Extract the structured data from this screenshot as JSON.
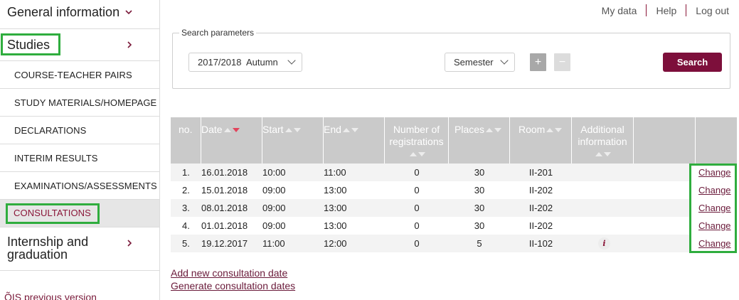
{
  "sidebar": {
    "general_information": "General information",
    "studies": "Studies",
    "sub_items": [
      "COURSE-TEACHER PAIRS",
      "STUDY MATERIALS/HOMEPAGE",
      "DECLARATIONS",
      "INTERIM RESULTS",
      "EXAMINATIONS/ASSESSMENTS",
      "CONSULTATIONS"
    ],
    "internship_line1": "Internship and",
    "internship_line2": "graduation",
    "previous_version": "ÕIS previous version"
  },
  "toplinks": {
    "my_data": "My data",
    "help": "Help",
    "log_out": "Log out"
  },
  "search": {
    "legend": "Search parameters",
    "period_value": "2017/2018  Autumn",
    "period_type": "Semester",
    "plus": "+",
    "minus": "−",
    "search_label": "Search"
  },
  "table": {
    "headers": {
      "no": "no.",
      "date": "Date",
      "start": "Start",
      "end": "End",
      "registrations_line1": "Number of",
      "registrations_line2": "registrations",
      "places": "Places",
      "room": "Room",
      "additional_line1": "Additional",
      "additional_line2": "information"
    },
    "rows": [
      {
        "no": "1.",
        "date": "16.01.2018",
        "start": "10:00",
        "end": "11:00",
        "registrations": "0",
        "places": "30",
        "room": "II-201",
        "info": false,
        "action": "Change"
      },
      {
        "no": "2.",
        "date": "15.01.2018",
        "start": "09:00",
        "end": "13:00",
        "registrations": "0",
        "places": "30",
        "room": "II-202",
        "info": false,
        "action": "Change"
      },
      {
        "no": "3.",
        "date": "08.01.2018",
        "start": "09:00",
        "end": "13:00",
        "registrations": "0",
        "places": "30",
        "room": "II-202",
        "info": false,
        "action": "Change"
      },
      {
        "no": "4.",
        "date": "01.01.2018",
        "start": "09:00",
        "end": "13:00",
        "registrations": "0",
        "places": "30",
        "room": "II-202",
        "info": false,
        "action": "Change"
      },
      {
        "no": "5.",
        "date": "19.12.2017",
        "start": "11:00",
        "end": "12:00",
        "registrations": "0",
        "places": "5",
        "room": "II-102",
        "info": true,
        "action": "Change"
      }
    ],
    "info_glyph": "i"
  },
  "links": {
    "add_new": "Add new consultation date",
    "generate": "Generate consultation dates"
  },
  "colors": {
    "brand": "#7d0f3b",
    "highlight_box": "#2fad3e",
    "header_bg": "#cacaca"
  }
}
